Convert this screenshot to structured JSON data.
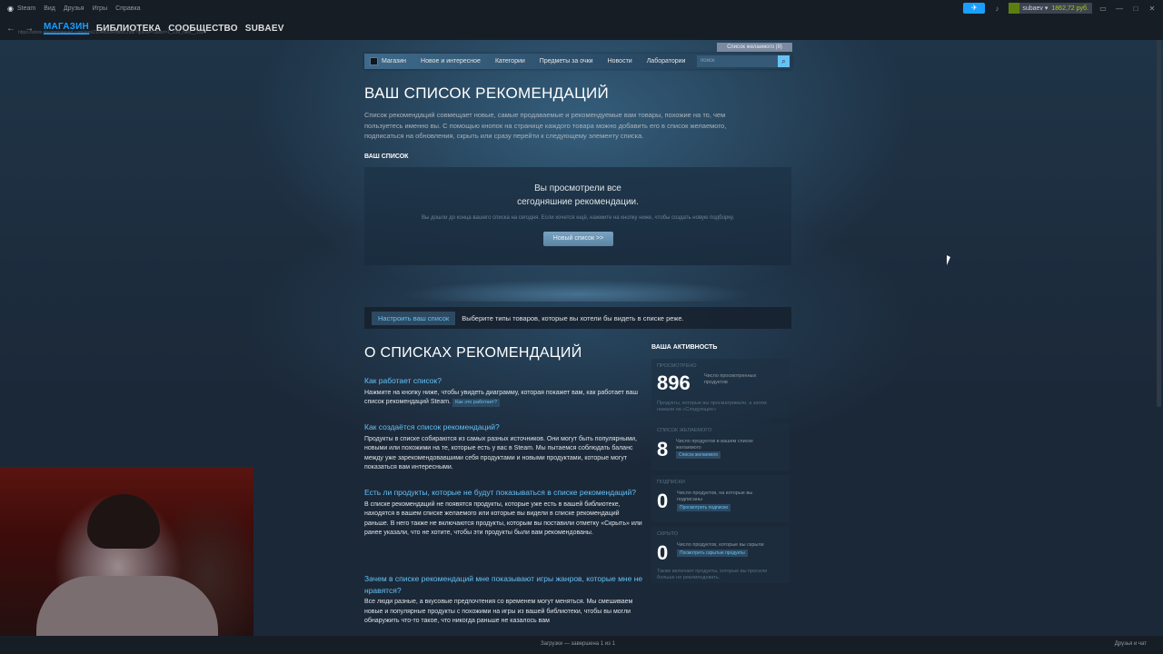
{
  "menubar": {
    "app": "Steam",
    "items": [
      "Вид",
      "Друзья",
      "Игры",
      "Справка"
    ],
    "username": "subaev",
    "balance": "1862,72 руб."
  },
  "nav": {
    "tabs": [
      "МАГАЗИН",
      "БИБЛИОТЕКА",
      "СООБЩЕСТВО",
      "SUBAEV"
    ],
    "url": "https://store.steampowered.com/app/2104890/RobotCraft/?queue=1&snr=1_239_next__1524"
  },
  "store": {
    "wishlist": "Список желаемого (8)",
    "nav_items": [
      "Магазин",
      "Новое и интересное",
      "Категории",
      "Предметы за очки",
      "Новости",
      "Лаборатории"
    ],
    "search_placeholder": "поиск"
  },
  "page": {
    "title": "ВАШ СПИСОК РЕКОМЕНДАЦИЙ",
    "intro": "Список рекомендаций совмещает новые, самые продаваемые и рекомендуемые вам товары, похожие на то, чем пользуетесь именно вы. С помощью кнопок на странице каждого товара можно добавить его в список желаемого, подписаться на обновления, скрыть или сразу перейти к следующему элементу списка.",
    "your_list": "ВАШ СПИСОК",
    "done_line1": "Вы просмотрели все",
    "done_line2": "сегодняшние рекомендации.",
    "done_sub": "Вы дошли до конца вашего списка на сегодня. Если хочется ещё, нажмите на кнопку ниже, чтобы создать новую подборку.",
    "new_list_button": "Новый список >>",
    "customize_button": "Настроить ваш список",
    "customize_text": "Выберите типы товаров, которые вы хотели бы видеть в списке реже."
  },
  "about": {
    "title": "О СПИСКАХ РЕКОМЕНДАЦИЙ",
    "faq": [
      {
        "q": "Как работает список?",
        "a": "Нажмите на кнопку ниже, чтобы увидеть диаграмму, которая покажет вам, как работает ваш список рекомендаций Steam.",
        "link": "Как это работает?"
      },
      {
        "q": "Как создаётся список рекомендаций?",
        "a": "Продукты в списке собираются из самых разных источников. Они могут быть популярными, новыми или похожими на те, которые есть у вас в Steam. Мы пытаемся соблюдать баланс между уже зарекомендовавшими себя продуктами и новыми продуктами, которые могут показаться вам интересными."
      },
      {
        "q": "Есть ли продукты, которые не будут показываться в списке рекомендаций?",
        "a": "В списке рекомендаций не появятся продукты, которые уже есть в вашей библиотеке, находятся в вашем списке желаемого или которые вы видели в списке рекомендаций раньше. В него также не включаются продукты, которым вы поставили отметку «Скрыть» или ранее указали, что не хотите, чтобы эти продукты были вам рекомендованы."
      },
      {
        "q": "Зачем в списке рекомендаций мне показывают игры жанров, которые мне не нравятся?",
        "a": "Все люди разные, а вкусовые предпочтения со временем могут меняться. Мы смешиваем новые и популярные продукты с похожими на игры из вашей библиотеки, чтобы вы могли обнаружить что-то такое, что никогда раньше не казалось вам"
      }
    ]
  },
  "activity": {
    "title": "ВАША АКТИВНОСТЬ",
    "viewed": {
      "label": "ПРОСМОТРЕНО",
      "count": "896",
      "desc": "Число просмотренных продуктов",
      "note": "Продукты, которые вы просматривали, а затем нажали на «Следующее»"
    },
    "wishlist": {
      "label": "СПИСОК ЖЕЛАЕМОГО",
      "count": "8",
      "desc": "Число продуктов в вашем списке желаемого",
      "link": "Список желаемого"
    },
    "followed": {
      "label": "ПОДПИСКИ",
      "count": "0",
      "desc": "Число продуктов, на которые вы подписаны",
      "link": "Просмотреть подписки"
    },
    "hidden": {
      "label": "СКРЫТО",
      "count": "0",
      "desc": "Число продуктов, которые вы скрыли",
      "link": "Посмотреть скрытые продукты",
      "note": "Также включает продукты, которые вы просили больше не рекомендовать."
    }
  },
  "bottom": {
    "downloads": "Загрузки — завершена 1 из 1",
    "friends": "Друзья и чат"
  }
}
